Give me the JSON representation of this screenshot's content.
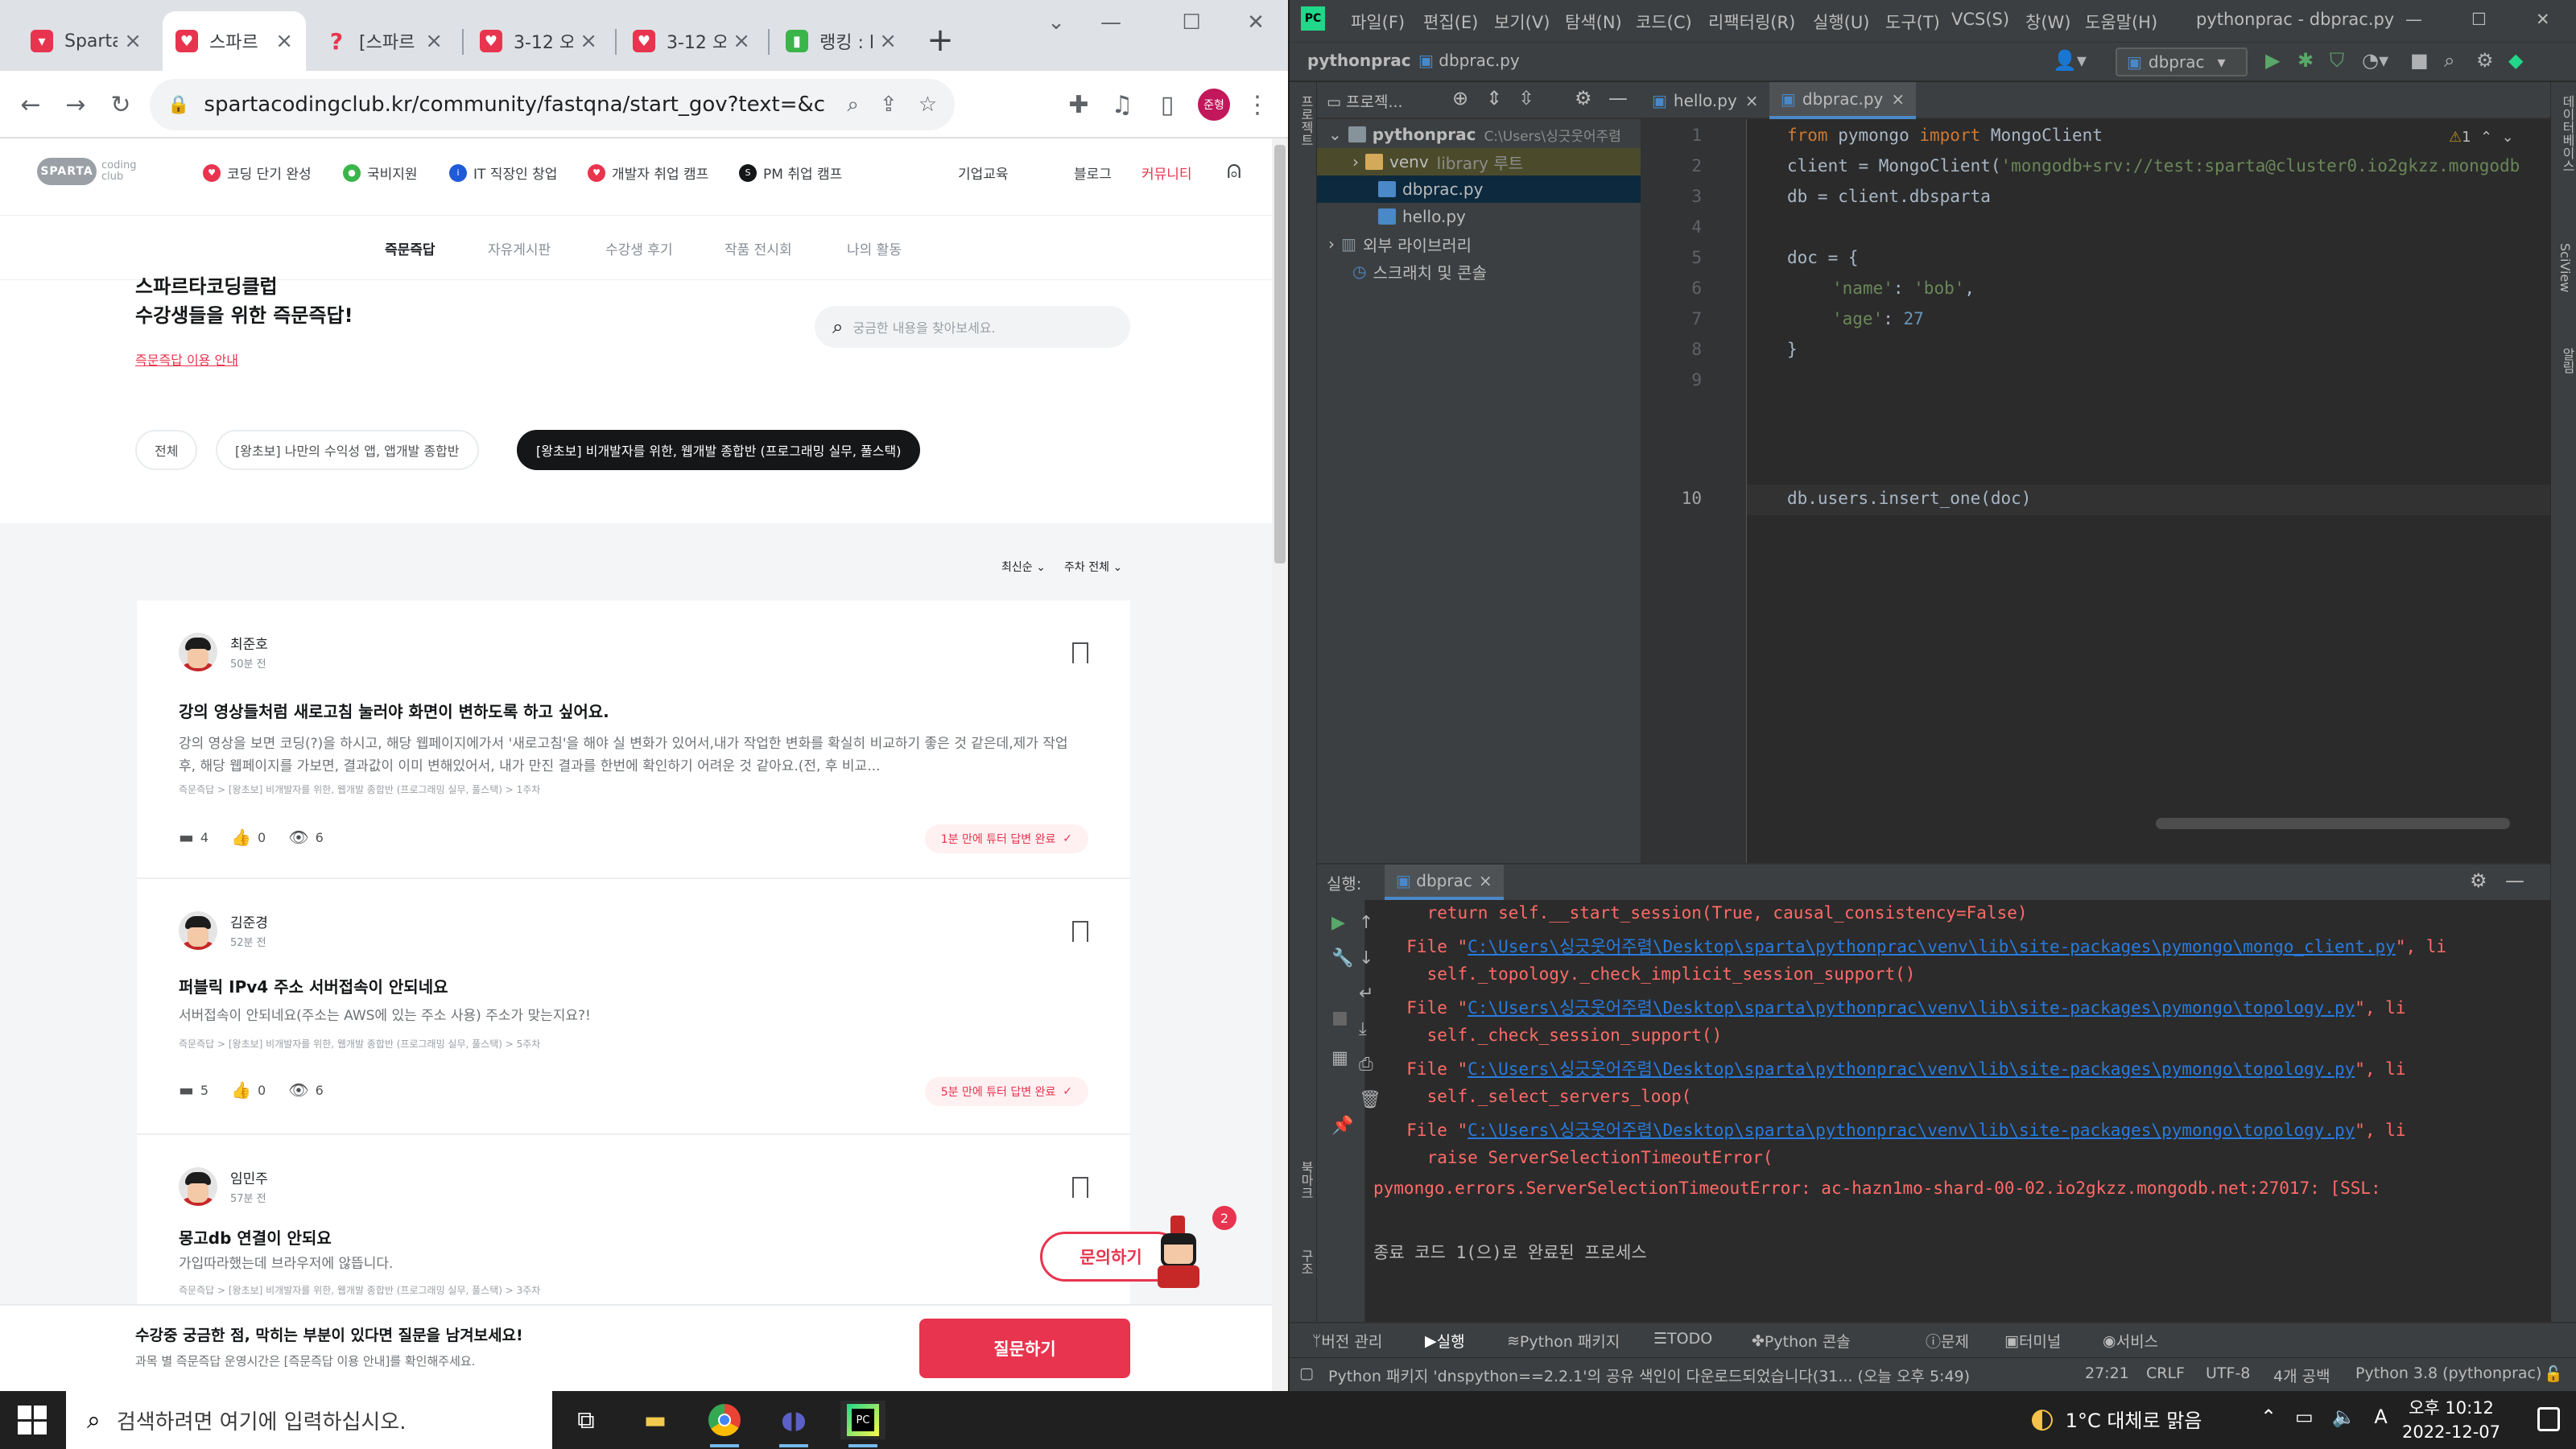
{
  "chrome": {
    "tabs": [
      {
        "title": "SpartaC"
      },
      {
        "title": "스파르"
      },
      {
        "title": "[스파르"
      },
      {
        "title": "3-12 오"
      },
      {
        "title": "3-12 오"
      },
      {
        "title": "랭킹 : l"
      }
    ],
    "url": "spartacodingclub.kr/community/fastqna/start_gov?text=&channelName=fast...",
    "profile": "준형"
  },
  "site": {
    "logo": "SPARTA",
    "logo_sub": "coding club",
    "nav": [
      "코딩 단기 완성",
      "국비지원",
      "IT 직장인 창업",
      "개발자 취업 캠프",
      "PM 취업 캠프",
      "기업교육",
      "블로그",
      "커뮤니티"
    ],
    "subnav": [
      "즉문즉답",
      "자유게시판",
      "수강생 후기",
      "작품 전시회",
      "나의 활동"
    ],
    "hero_title_1": "스파르타코딩클럽",
    "hero_title_2": "수강생들을 위한 즉문즉답!",
    "hero_link": "즉문즉답 이용 안내",
    "search_placeholder": "궁금한 내용을 찾아보세요.",
    "chips": [
      "전체",
      "[왕초보] 나만의 수익성 앱, 앱개발 종합반",
      "[왕초보] 비개발자를 위한, 웹개발 종합반 (프로그래밍 실무, 풀스택)"
    ],
    "sort_latest": "최신순",
    "sort_week": "주차 전체",
    "posts": [
      {
        "author": "최준호",
        "time": "50분 전",
        "title": "강의 영상들처럼 새로고침 눌러야 화면이 변하도록 하고 싶어요.",
        "body": "강의 영상을 보면 코딩(?)을 하시고, 해당 웹페이지에가서 '새로고침'을 해야 실 변화가 있어서,내가 작업한 변화를 확실히 비교하기 좋은 것 같은데,제가 작업후, 해당 웹페이지를 가보면, 결과값이 이미 변해있어서, 내가 만진 결과를 한번에 확인하기 어려운 것 같아요.(전, 후 비교...",
        "meta": "즉문즉답 > [왕초보] 비개발자를 위한, 웹개발 종합반 (프로그래밍 실무, 풀스택) > 1주차",
        "comments": "4",
        "likes": "0",
        "views": "6",
        "answered": "1분 만에 튜터 답변 완료"
      },
      {
        "author": "김준경",
        "time": "52분 전",
        "title": "퍼블릭 IPv4 주소 서버접속이 안되네요",
        "body": "서버접속이 안되네요(주소는 AWS에 있는 주소 사용) 주소가 맞는지요?!",
        "meta": "즉문즉답 > [왕초보] 비개발자를 위한, 웹개발 종합반 (프로그래밍 실무, 풀스택) > 5주차",
        "comments": "5",
        "likes": "0",
        "views": "6",
        "answered": "5분 만에 튜터 답변 완료"
      },
      {
        "author": "임민주",
        "time": "57분 전",
        "title": "몽고db 연결이 안되요",
        "body": "가입따라했는데 브라우저에 않뜹니다.",
        "meta": "즉문즉답 > [왕초보] 비개발자를 위한, 웹개발 종합반 (프로그래밍 실무, 풀스택) > 3주차"
      }
    ],
    "ask_float": "문의하기",
    "ask_badge": "2",
    "bottom_title": "수강중 궁금한 점, 막히는 부분이 있다면 질문을 남겨보세요!",
    "bottom_sub": "과목 별 즉문즉답 운영시간은 [즉문즉답 이용 안내]를 확인해주세요.",
    "bottom_btn": "질문하기"
  },
  "ide": {
    "menus": [
      "파일(F)",
      "편집(E)",
      "보기(V)",
      "탐색(N)",
      "코드(C)",
      "리팩터링(R)",
      "실행(U)",
      "도구(T)",
      "VCS(S)",
      "창(W)",
      "도움말(H)"
    ],
    "window_title": "pythonprac - dbprac.py",
    "crumb_project": "pythonprac",
    "crumb_file": "dbprac.py",
    "run_config": "dbprac",
    "project_label": "프로젝...",
    "left_strip": "프로젝트",
    "right_strip_1": "데이터베이스",
    "right_strip_2": "SciView",
    "right_strip_3": "알림",
    "left_strip_2": "북마크",
    "left_strip_3": "구조",
    "tree": {
      "root": "pythonprac",
      "root_path": "C:\\Users\\싱긋웃어주렴",
      "venv": "venv",
      "venv_hint": "library 루트",
      "file1": "dbprac.py",
      "file2": "hello.py",
      "ext": "외부 라이브러리",
      "scratch": "스크래치 및 콘솔"
    },
    "editor_tabs": [
      "hello.py",
      "dbprac.py"
    ],
    "warning": "1",
    "line_numbers": [
      "1",
      "2",
      "3",
      "4",
      "5",
      "6",
      "7",
      "8",
      "9",
      "10"
    ],
    "code": {
      "l1_from": "from",
      "l1_mod": " pymongo ",
      "l1_import": "import",
      "l1_name": " MongoClient",
      "l2_a": "client = MongoClient(",
      "l2_str": "'mongodb+srv://test:sparta@cluster0.io2gkzz.mongodb",
      "l3": "db = client.dbsparta",
      "l5": "doc = {",
      "l6_k": "'name'",
      "l6_c": ": ",
      "l6_v": "'bob'",
      "l6_e": ",",
      "l7_k": "'age'",
      "l7_c": ": ",
      "l7_v": "27",
      "l8": "}",
      "l10": "db.users.insert_one(doc)"
    },
    "run_label": "실행:",
    "run_tab": "dbprac",
    "output": {
      "o1": "    return self.__start_session(True, causal_consistency=False)",
      "file_prefix": "  File \"",
      "p2": "C:\\Users\\싱긋웃어주렴\\Desktop\\sparta\\pythonprac\\venv\\lib\\site-packages\\pymongo\\mongo_client.py",
      "s2": "\", li",
      "o3": "    self._topology._check_implicit_session_support()",
      "p4": "C:\\Users\\싱긋웃어주렴\\Desktop\\sparta\\pythonprac\\venv\\lib\\site-packages\\pymongo\\topology.py",
      "s4": "\", li",
      "o5": "    self._check_session_support()",
      "p6": "C:\\Users\\싱긋웃어주렴\\Desktop\\sparta\\pythonprac\\venv\\lib\\site-packages\\pymongo\\topology.py",
      "s6": "\", li",
      "o7": "    self._select_servers_loop(",
      "p8": "C:\\Users\\싱긋웃어주렴\\Desktop\\sparta\\pythonprac\\venv\\lib\\site-packages\\pymongo\\topology.py",
      "s8": "\", li",
      "o9": "    raise ServerSelectionTimeoutError(",
      "o10": "pymongo.errors.ServerSelectionTimeoutError: ac-hazn1mo-shard-00-02.io2gkzz.mongodb.net:27017: [SSL:",
      "o11": "종료 코드 1(으)로 완료된 프로세스"
    },
    "tool_tabs": [
      "버전 관리",
      "실행",
      "Python 패키지",
      "TODO",
      "Python 콘솔",
      "문제",
      "터미널",
      "서비스"
    ],
    "status_msg": "Python 패키지 'dnspython==2.2.1'의 공유 색인이 다운로드되었습니다(31... (오늘 오후 5:49)",
    "status_pos": "27:21",
    "status_crlf": "CRLF",
    "status_enc": "UTF-8",
    "status_indent": "4개 공백",
    "status_py": "Python 3.8 (pythonprac)"
  },
  "taskbar": {
    "search": "검색하려면 여기에 입력하십시오.",
    "weather": "1°C  대체로 맑음",
    "time": "오후 10:12",
    "date": "2022-12-07",
    "ime": "A"
  },
  "colors": {
    "brand": "#e8344e",
    "ide_bg": "#2b2b2b",
    "keyword": "#cc7832",
    "string": "#6a8759"
  }
}
